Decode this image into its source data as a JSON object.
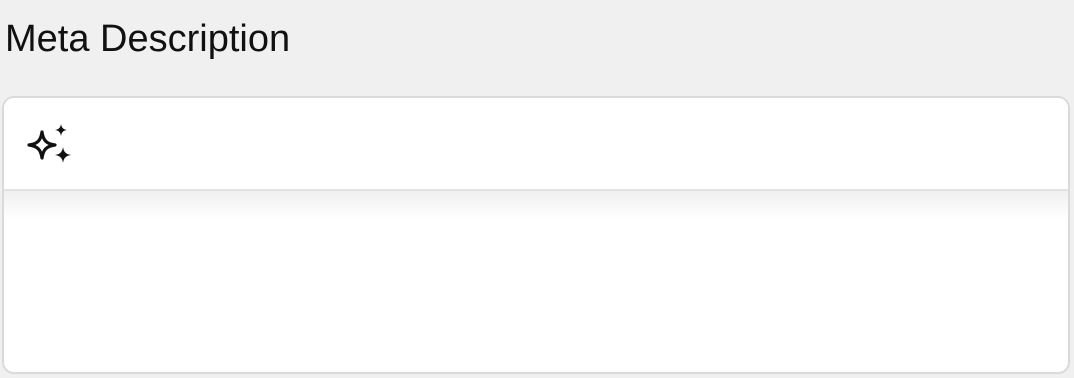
{
  "field": {
    "label": "Meta Description"
  },
  "editor": {
    "content": "",
    "toolbar": {
      "ai_button_icon": "sparkles-icon"
    }
  },
  "colors": {
    "page_background": "#f0f0f0",
    "editor_background": "#ffffff",
    "border": "#dadada",
    "icon": "#111111"
  }
}
